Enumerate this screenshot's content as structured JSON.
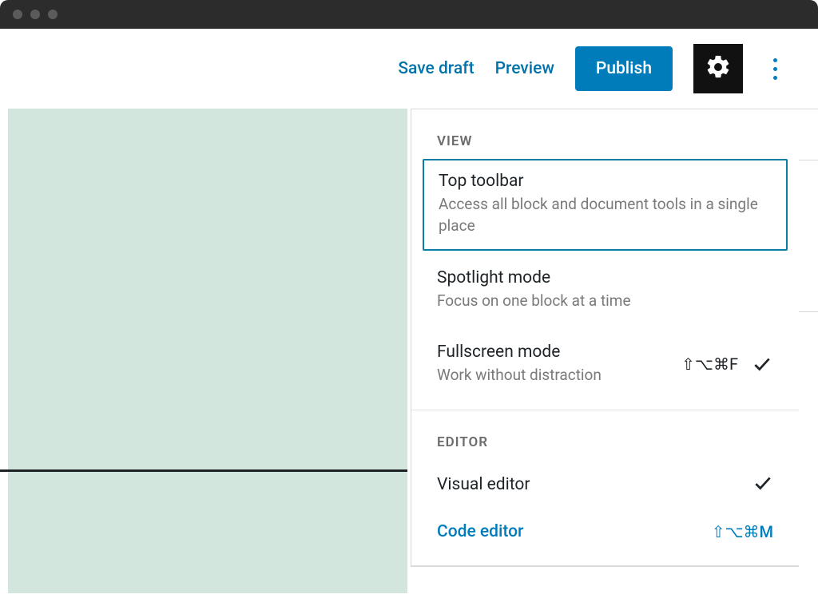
{
  "toolbar": {
    "save_draft": "Save draft",
    "preview": "Preview",
    "publish": "Publish"
  },
  "menu": {
    "view_label": "VIEW",
    "editor_label": "EDITOR",
    "items": {
      "top_toolbar": {
        "title": "Top toolbar",
        "desc": "Access all block and document tools in a single place"
      },
      "spotlight": {
        "title": "Spotlight mode",
        "desc": "Focus on one block at a time"
      },
      "fullscreen": {
        "title": "Fullscreen mode",
        "desc": "Work without distraction",
        "shortcut": "⇧⌥⌘F"
      }
    },
    "editors": {
      "visual": {
        "label": "Visual editor"
      },
      "code": {
        "label": "Code editor",
        "shortcut": "⇧⌥⌘M"
      }
    }
  }
}
